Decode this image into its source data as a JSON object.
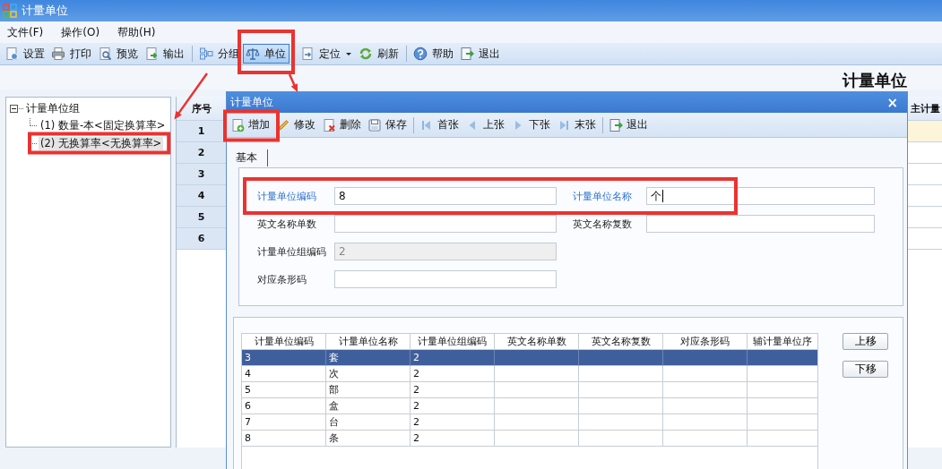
{
  "window": {
    "title": "计量单位"
  },
  "menu": [
    "文件(F)",
    "操作(O)",
    "帮助(H)"
  ],
  "toolbar": {
    "groups": [
      [
        {
          "label": "设置",
          "selected": false
        },
        {
          "label": "打印",
          "selected": false
        },
        {
          "label": "预览",
          "selected": false
        },
        {
          "label": "输出",
          "selected": false
        }
      ],
      [
        {
          "label": "分组",
          "selected": false
        },
        {
          "label": "单位",
          "selected": true
        }
      ],
      [
        {
          "label": "定位",
          "selected": false,
          "dropdown": true
        },
        {
          "label": "刷新",
          "selected": false
        }
      ],
      [
        {
          "label": "帮助",
          "selected": false
        },
        {
          "label": "退出",
          "selected": false
        }
      ]
    ]
  },
  "page_heading": "计量单位",
  "tree": {
    "items": [
      {
        "label": "计量单位组",
        "expanded": true,
        "selected": false,
        "children": [
          {
            "label": "(1) 数量-本<固定换算率>",
            "selected": false
          },
          {
            "label": "(2) 无换算率<无换算率>",
            "selected": true
          }
        ]
      }
    ]
  },
  "main_grid": {
    "columns": [
      "序号",
      "主计量"
    ],
    "rows": [
      {
        "index": "1",
        "selected": true
      },
      {
        "index": "2",
        "selected": false
      },
      {
        "index": "3",
        "selected": false
      },
      {
        "index": "4",
        "selected": false
      },
      {
        "index": "5",
        "selected": false
      },
      {
        "index": "6",
        "selected": false
      }
    ]
  },
  "dialog": {
    "title": "计量单位",
    "close_symbol": "×",
    "toolbar": {
      "groups": [
        [
          "增加",
          "修改",
          "删除",
          "保存"
        ],
        [
          "首张",
          "上张",
          "下张",
          "末张"
        ],
        [
          "退出"
        ]
      ]
    },
    "tabs": [
      {
        "label": "基本",
        "selected": true
      }
    ],
    "form_rows": [
      [
        {
          "label": "计量单位编码",
          "value": "8",
          "required": true,
          "disabled": false,
          "focused": false
        },
        {
          "label": "计量单位名称",
          "value": "个",
          "required": true,
          "disabled": false,
          "focused": true
        }
      ],
      [
        {
          "label": "英文名称单数",
          "required": false,
          "disabled": false,
          "focused": false
        },
        {
          "label": "英文名称复数",
          "required": false,
          "disabled": false,
          "focused": false
        }
      ],
      [
        {
          "label": "计量单位组编码",
          "value": "2",
          "required": false,
          "disabled": true,
          "focused": false
        }
      ],
      [
        {
          "label": "对应条形码",
          "required": false,
          "disabled": false,
          "focused": false
        }
      ]
    ],
    "grid": {
      "columns": [
        "计量单位编码",
        "计量单位名称",
        "计量单位组编码",
        "英文名称单数",
        "英文名称复数",
        "对应条形码",
        "辅计量单位序"
      ],
      "rows": [
        {
          "cells": [
            "3",
            "套",
            "2"
          ],
          "selected": true
        },
        {
          "cells": [
            "4",
            "次",
            "2"
          ],
          "selected": false
        },
        {
          "cells": [
            "5",
            "部",
            "2"
          ],
          "selected": false
        },
        {
          "cells": [
            "6",
            "盒",
            "2"
          ],
          "selected": false
        },
        {
          "cells": [
            "7",
            "台",
            "2"
          ],
          "selected": false
        },
        {
          "cells": [
            "8",
            "条",
            "2"
          ],
          "selected": false
        }
      ]
    },
    "buttons": [
      "上移",
      "下移"
    ]
  }
}
